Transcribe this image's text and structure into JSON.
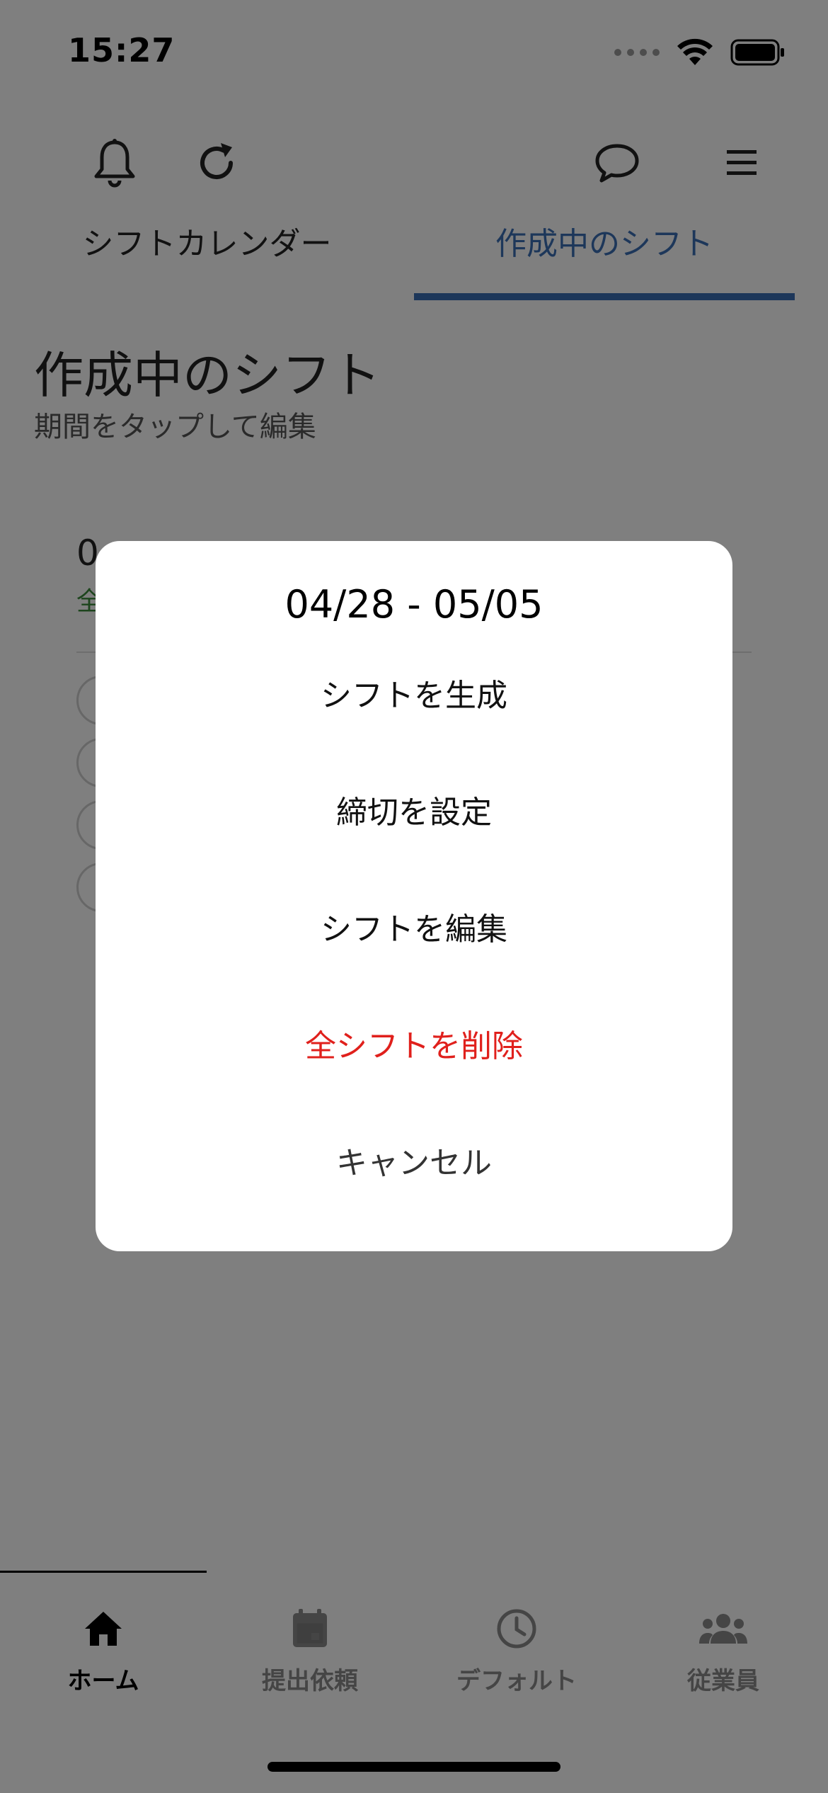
{
  "status_bar": {
    "time": "15:27"
  },
  "tabs": [
    {
      "label": "シフトカレンダー"
    },
    {
      "label": "作成中のシフト"
    }
  ],
  "page": {
    "title": "作成中のシフト",
    "subtitle": "期間をタップして編集"
  },
  "period_card": {
    "date_visible": "0",
    "status_visible": "全"
  },
  "dialog": {
    "title": "04/28 - 05/05",
    "options": [
      {
        "label": "シフトを生成"
      },
      {
        "label": "締切を設定"
      },
      {
        "label": "シフトを編集"
      },
      {
        "label": "全シフトを削除"
      },
      {
        "label": "キャンセル"
      }
    ]
  },
  "bottom_nav": [
    {
      "label": "ホーム",
      "icon": "home-icon"
    },
    {
      "label": "提出依頼",
      "icon": "calendar-icon"
    },
    {
      "label": "デフォルト",
      "icon": "clock-icon"
    },
    {
      "label": "従業員",
      "icon": "people-icon"
    }
  ],
  "colors": {
    "accent": "#3b6eb4",
    "danger": "#e0201c",
    "success": "#3a8a3a"
  }
}
